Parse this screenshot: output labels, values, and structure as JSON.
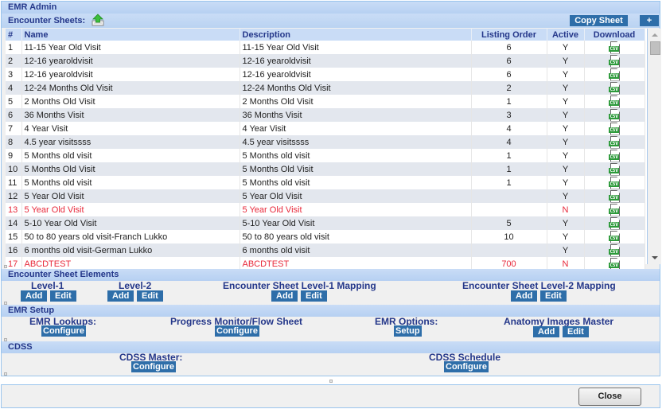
{
  "header": {
    "title": "EMR Admin"
  },
  "sheets": {
    "title": "Encounter Sheets:",
    "upload_icon": "upload-arrow-icon",
    "copy_label": "Copy Sheet",
    "add_label": "+",
    "columns": [
      "#",
      "Name",
      "Description",
      "Listing Order",
      "Active",
      "Download"
    ],
    "download_icon": "csv-icon",
    "csv_text": "CSV",
    "rows": [
      {
        "num": "1",
        "name": "11-15 Year Old Visit",
        "description": "11-15 Year Old Visit",
        "order": "6",
        "active": "Y"
      },
      {
        "num": "2",
        "name": "12-16 yearoldvisit",
        "description": "12-16 yearoldvisit",
        "order": "6",
        "active": "Y"
      },
      {
        "num": "3",
        "name": "12-16 yearoldvisit",
        "description": "12-16 yearoldvisit",
        "order": "6",
        "active": "Y"
      },
      {
        "num": "4",
        "name": "12-24 Months Old Visit",
        "description": "12-24 Months Old Visit",
        "order": "2",
        "active": "Y"
      },
      {
        "num": "5",
        "name": "2 Months Old Visit",
        "description": "2 Months Old Visit",
        "order": "1",
        "active": "Y"
      },
      {
        "num": "6",
        "name": "36 Months Visit",
        "description": "36 Months Visit",
        "order": "3",
        "active": "Y"
      },
      {
        "num": "7",
        "name": "4 Year Visit",
        "description": "4 Year Visit",
        "order": "4",
        "active": "Y"
      },
      {
        "num": "8",
        "name": "4.5 year visitssss",
        "description": "4.5 year visitssss",
        "order": "4",
        "active": "Y"
      },
      {
        "num": "9",
        "name": "5 Months old visit",
        "description": "5 Months old visit",
        "order": "1",
        "active": "Y"
      },
      {
        "num": "10",
        "name": "5 Months Old Visit",
        "description": "5 Months Old Visit",
        "order": "1",
        "active": "Y"
      },
      {
        "num": "11",
        "name": "5 Months old visit",
        "description": "5 Months old visit",
        "order": "1",
        "active": "Y"
      },
      {
        "num": "12",
        "name": "5 Year Old Visit",
        "description": "5 Year Old Visit",
        "order": "",
        "active": "Y"
      },
      {
        "num": "13",
        "name": "5 Year Old Visit",
        "description": "5 Year Old Visit",
        "order": "",
        "active": "N"
      },
      {
        "num": "14",
        "name": "5-10 Year Old Visit",
        "description": "5-10 Year Old Visit",
        "order": "5",
        "active": "Y"
      },
      {
        "num": "15",
        "name": "50 to 80 years old visit-Franch Lukko",
        "description": "50 to 80 years old visit",
        "order": "10",
        "active": "Y"
      },
      {
        "num": "16",
        "name": "6 months old visit-German Lukko",
        "description": "6 months old visit",
        "order": "",
        "active": "Y"
      },
      {
        "num": "17",
        "name": "ABCDTEST",
        "description": "ABCDTEST",
        "order": "700",
        "active": "N"
      }
    ]
  },
  "elements": {
    "title": "Encounter Sheet Elements",
    "level1": "Level-1",
    "level2": "Level-2",
    "mapping1": "Encounter Sheet Level-1 Mapping",
    "mapping2": "Encounter Sheet Level-2 Mapping",
    "add_label": "Add",
    "edit_label": "Edit"
  },
  "setup": {
    "title": "EMR Setup",
    "lookups": "EMR Lookups:",
    "progress": "Progress Monitor/Flow Sheet",
    "options": "EMR Options:",
    "anatomy": "Anatomy Images Master",
    "configure_label": "Configure",
    "setup_label": "Setup",
    "add_label": "Add",
    "edit_label": "Edit"
  },
  "cdss": {
    "title": "CDSS",
    "master": "CDSS Master:",
    "schedule": "CDSS Schedule",
    "configure_label": "Configure"
  },
  "footer": {
    "close_label": "Close"
  },
  "colors": {
    "accent_button": "#2e6ea9",
    "header_text": "#24378a",
    "inactive_text": "#e8283a",
    "csv_green": "#2c9a3a"
  }
}
